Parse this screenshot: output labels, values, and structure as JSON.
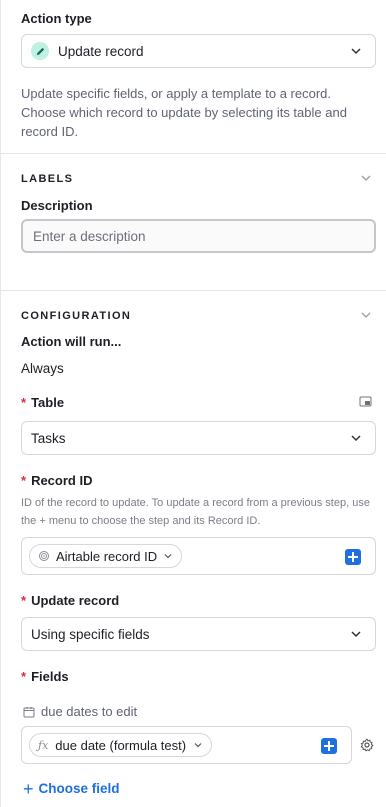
{
  "action_type": {
    "label": "Action type",
    "selected": "Update record",
    "description": "Update specific fields, or apply a template to a record. Choose which record to update by selecting its table and record ID."
  },
  "labels_section": {
    "header": "LABELS",
    "description_label": "Description",
    "description_placeholder": "Enter a description"
  },
  "configuration": {
    "header": "CONFIGURATION",
    "run_label": "Action will run...",
    "run_value": "Always",
    "table_label": "Table",
    "table_value": "Tasks",
    "record_id_label": "Record ID",
    "record_id_help": "ID of the record to update. To update a record from a previous step, use the + menu to choose the step and its Record ID.",
    "record_id_token": "Airtable record ID",
    "update_label": "Update record",
    "update_value": "Using specific fields",
    "fields_label": "Fields",
    "field_name": "due dates to edit",
    "field_token": "due date (formula test)",
    "choose_field": "Choose field"
  },
  "colors": {
    "accent": "#1f6fe0",
    "required": "#dc2a40",
    "action_icon_bg": "#bff0e2"
  }
}
